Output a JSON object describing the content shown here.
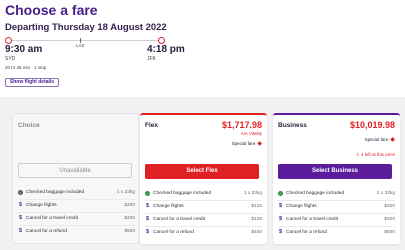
{
  "page": {
    "title": "Choose a fare",
    "depart_title": "Departing Thursday 18 August 2022"
  },
  "flight": {
    "departure_time": "9:30 am",
    "departure_code": "SYD",
    "arrival_time": "4:18 pm",
    "arrival_code": "JFK",
    "stop_code": "LAX",
    "duration": "20 hr 48 min · 1 stop",
    "details_button": "Show flight details"
  },
  "fares": {
    "choice": {
      "name": "Choice",
      "button": "Unavailable",
      "features": [
        {
          "label": "Checked baggage included",
          "value": "1 x 23kg",
          "icon": "check-icon"
        },
        {
          "label": "Change flights",
          "value": "$200",
          "icon": "dollar-icon"
        },
        {
          "label": "Cancel for a travel credit",
          "value": "$200",
          "icon": "dollar-icon"
        },
        {
          "label": "Cancel for a refund",
          "value": "$500",
          "icon": "dollar-icon"
        }
      ]
    },
    "flex": {
      "name": "Flex",
      "price": "$1,717.98",
      "velocity": "AIA Vitality",
      "special": "Special fare",
      "button": "Select Flex",
      "features": [
        {
          "label": "Checked baggage included",
          "value": "1 x 23kg",
          "icon": "check-icon"
        },
        {
          "label": "Change flights",
          "value": "$125",
          "icon": "dollar-icon"
        },
        {
          "label": "Cancel for a travel credit",
          "value": "$125",
          "icon": "dollar-icon"
        },
        {
          "label": "Cancel for a refund",
          "value": "$400",
          "icon": "dollar-icon"
        }
      ]
    },
    "business": {
      "name": "Business",
      "price": "$10,019.98",
      "special": "Special fare",
      "seats_left": "4 left at this price",
      "button": "Select Business",
      "features": [
        {
          "label": "Checked baggage included",
          "value": "2 x 32kg",
          "icon": "check-icon"
        },
        {
          "label": "Change flights",
          "value": "$400",
          "icon": "dollar-icon"
        },
        {
          "label": "Cancel for a travel credit",
          "value": "$400",
          "icon": "dollar-icon"
        },
        {
          "label": "Cancel for a refund",
          "value": "$600",
          "icon": "dollar-icon"
        }
      ]
    }
  },
  "colors": {
    "brand_purple": "#4a1d8c",
    "flex_red": "#e02124",
    "business_purple": "#5b1b9a"
  }
}
